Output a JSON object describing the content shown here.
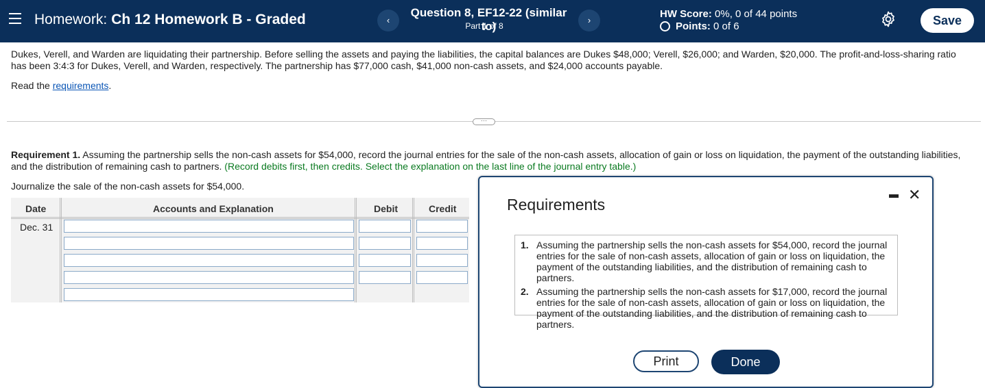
{
  "header": {
    "title_prefix": "Homework:",
    "title": "Ch 12 Homework B - Graded",
    "question_title": "Question 8, EF12-22 (similar to)",
    "question_sub": "Part 1 of 8",
    "hw_score_label": "HW Score:",
    "hw_score_value": "0%, 0 of 44 points",
    "points_label": "Points:",
    "points_value": "0 of 6",
    "save_label": "Save",
    "prev_icon": "‹",
    "next_icon": "›"
  },
  "problem": {
    "text": "Dukes, Verell, and Warden are liquidating their partnership. Before selling the assets and paying the liabilities, the capital balances are Dukes $48,000; Verell, $26,000; and Warden, $20,000. The profit-and-loss-sharing ratio has been 3:4:3 for Dukes, Verell, and Warden, respectively. The partnership has $77,000 cash, $41,000 non-cash assets, and $24,000 accounts payable.",
    "read_prefix": "Read the ",
    "read_link": "requirements",
    "read_suffix": "."
  },
  "requirement": {
    "label": "Requirement 1.",
    "text": " Assuming the partnership sells the non-cash assets for $54,000, record the journal entries for the sale of the non-cash assets, allocation of gain or loss on liquidation, the payment of the outstanding liabilities, and the distribution of remaining cash to partners. ",
    "instruction": "(Record debits first, then credits. Select the explanation on the last line of the journal entry table.)",
    "journalize": "Journalize the sale of the non-cash assets for $54,000."
  },
  "journal": {
    "headers": {
      "date": "Date",
      "accounts": "Accounts and Explanation",
      "debit": "Debit",
      "credit": "Credit"
    },
    "date": "Dec. 31",
    "rows": [
      {
        "account": "",
        "debit": "",
        "credit": ""
      },
      {
        "account": "",
        "debit": "",
        "credit": ""
      },
      {
        "account": "",
        "debit": "",
        "credit": ""
      },
      {
        "account": "",
        "debit": "",
        "credit": ""
      },
      {
        "account": ""
      }
    ]
  },
  "modal": {
    "title": "Requirements",
    "items": [
      {
        "num": "1.",
        "text": "Assuming the partnership sells the non-cash assets for $54,000, record the journal entries for the sale of non-cash assets, allocation of gain or loss on liquidation, the payment of the outstanding liabilities, and the distribution of remaining cash to partners."
      },
      {
        "num": "2.",
        "text": "Assuming the partnership sells the non-cash assets for $17,000, record the journal entries for the sale of non-cash assets, allocation of gain or loss on liquidation, the payment of the outstanding liabilities, and the distribution of remaining cash to partners."
      }
    ],
    "print_label": "Print",
    "done_label": "Done",
    "close_icon": "✕"
  }
}
